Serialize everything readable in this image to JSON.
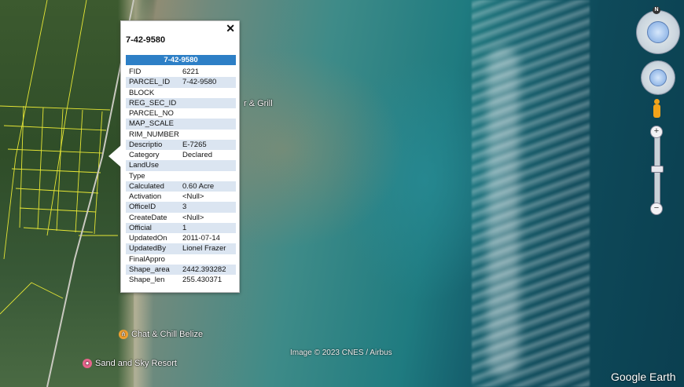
{
  "popup": {
    "title": "7-42-9580",
    "header": "7-42-9580",
    "close_glyph": "✕",
    "rows": [
      {
        "key": "FID",
        "value": "6221"
      },
      {
        "key": "PARCEL_ID",
        "value": "7-42-9580"
      },
      {
        "key": "BLOCK",
        "value": ""
      },
      {
        "key": "REG_SEC_ID",
        "value": ""
      },
      {
        "key": "PARCEL_NO",
        "value": ""
      },
      {
        "key": "MAP_SCALE",
        "value": ""
      },
      {
        "key": "RIM_NUMBER",
        "value": ""
      },
      {
        "key": "Descriptio",
        "value": "E-7265"
      },
      {
        "key": "Category",
        "value": "Declared"
      },
      {
        "key": "LandUse",
        "value": ""
      },
      {
        "key": "Type",
        "value": ""
      },
      {
        "key": "Calculated",
        "value": "0.60 Acre"
      },
      {
        "key": "Activation",
        "value": "<Null>"
      },
      {
        "key": "OfficeID",
        "value": "3"
      },
      {
        "key": "CreateDate",
        "value": "<Null>"
      },
      {
        "key": "Official",
        "value": "1"
      },
      {
        "key": "UpdatedOn",
        "value": "2011-07-14"
      },
      {
        "key": "UpdatedBy",
        "value": "Lionel Frazer"
      },
      {
        "key": "FinalAppro",
        "value": ""
      },
      {
        "key": "Shape_area",
        "value": "2442.393282"
      },
      {
        "key": "Shape_len",
        "value": "255.430371"
      }
    ]
  },
  "map": {
    "labels": {
      "bar_grill_partial": "r & Grill",
      "chat_chill": "Chat & Chill Belize",
      "sand_sky": "Sand and Sky Resort"
    },
    "attribution": "Image © 2023 CNES / Airbus",
    "brand": "Google Earth",
    "icons": {
      "restaurant": "fork-knife-icon",
      "hotel": "location-pin-icon"
    },
    "colors": {
      "parcel_lines": "#e6e635",
      "popup_header": "#2d7fc6",
      "row_alt": "#dbe5f1"
    }
  },
  "controls": {
    "north_label": "N",
    "zoom_in": "+",
    "zoom_out": "−"
  }
}
